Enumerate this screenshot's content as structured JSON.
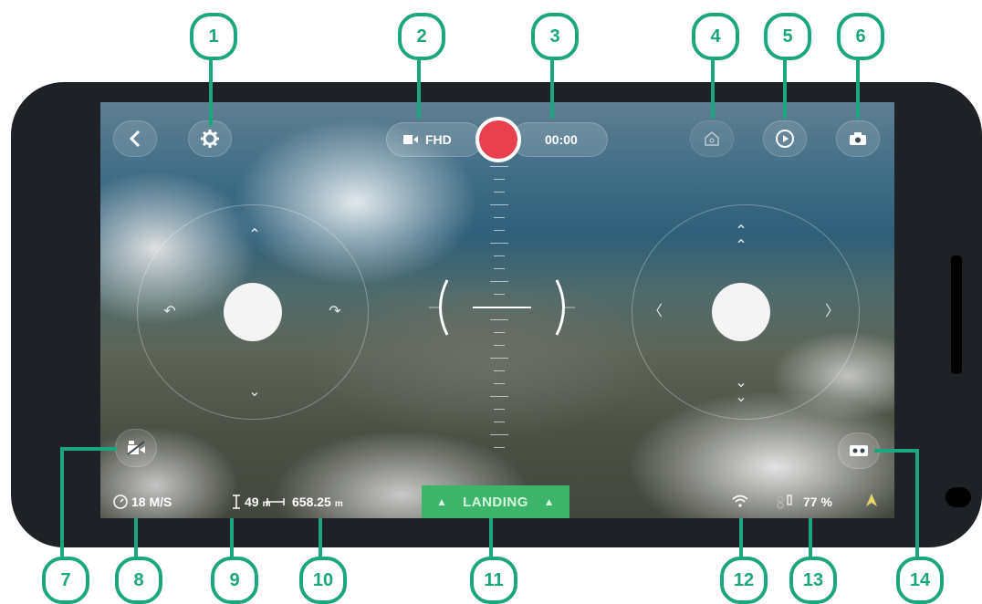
{
  "top_bar": {
    "back_icon": "chevron-left-icon",
    "settings_icon": "gear-icon",
    "video_quality": "FHD",
    "video_icon": "video-camera-icon",
    "record_time": "00:00",
    "record_color": "#e8404f",
    "home_icon": "home-icon",
    "playback_icon": "play-icon",
    "camera_icon": "camera-icon"
  },
  "left_joystick": {
    "up_icon": "chevron-up-icon",
    "down_icon": "chevron-down-icon",
    "rotate_left_icon": "rotate-left-icon",
    "rotate_right_icon": "rotate-right-icon"
  },
  "right_joystick": {
    "up_icon": "double-chevron-up-icon",
    "down_icon": "double-chevron-down-icon",
    "left_icon": "chevron-left-icon",
    "right_icon": "chevron-right-icon"
  },
  "mode_button_icon": "camera-mode-icon",
  "vr_button_icon": "vr-goggles-icon",
  "status_bar": {
    "speed": "18 M/S",
    "altitude": "49",
    "altitude_unit": "m",
    "distance": "658.25",
    "distance_unit": "m",
    "landing_label": "LANDING",
    "battery": "77 %",
    "wifi_icon": "wifi-icon",
    "drone_icon": "drone-icon",
    "compass_icon": "compass-arrow-icon"
  },
  "callouts": [
    "1",
    "2",
    "3",
    "4",
    "5",
    "6",
    "7",
    "8",
    "9",
    "10",
    "11",
    "12",
    "13",
    "14"
  ],
  "colors": {
    "accent": "#1ba67d",
    "landing": "#3cb56a",
    "record": "#e8404f"
  }
}
